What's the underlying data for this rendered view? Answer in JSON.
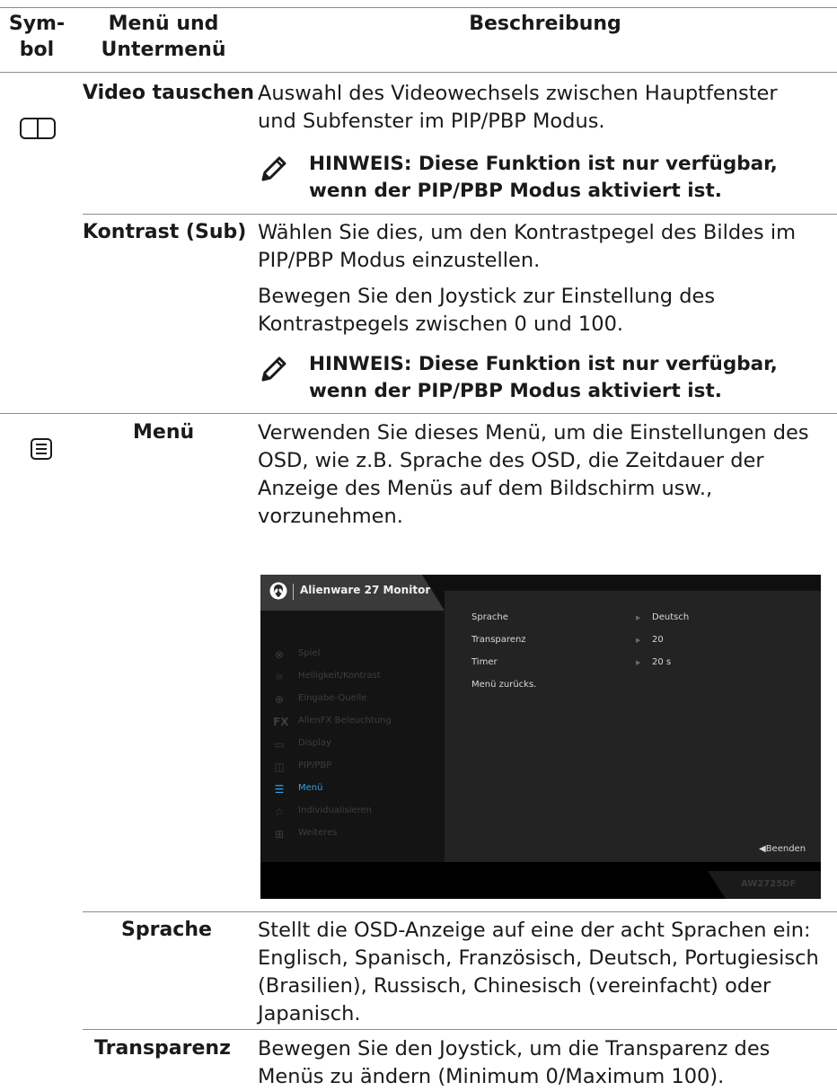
{
  "header": {
    "symbol": [
      "Sym-",
      "bol"
    ],
    "menu": [
      "Menü und",
      "Untermenü"
    ],
    "description": "Beschreibung"
  },
  "rows": {
    "video": {
      "name": "Video tauschen",
      "icon": "split-screen-icon",
      "desc": [
        "Auswahl des Videowechsels zwischen Hauptfenster",
        "und Subfenster im PIP/PBP Modus."
      ],
      "note": [
        "HINWEIS: Diese Funktion ist nur verfügbar,",
        "wenn der PIP/PBP Modus aktiviert ist."
      ]
    },
    "kontrast": {
      "name": "Kontrast (Sub)",
      "desc": [
        "Wählen Sie dies, um den Kontrastpegel des Bildes im",
        "PIP/PBP Modus einzustellen."
      ],
      "desc2": [
        "Bewegen Sie den Joystick zur Einstellung des",
        "Kontrastpegels zwischen 0 und 100."
      ],
      "note": [
        "HINWEIS: Diese Funktion ist nur verfügbar,",
        "wenn der PIP/PBP Modus aktiviert ist."
      ]
    },
    "menu": {
      "name": "Menü",
      "icon": "menu-list-icon",
      "desc": [
        "Verwenden Sie dieses Menü, um die Einstellungen des",
        "OSD, wie z.B. Sprache des OSD, die Zeitdauer der",
        "Anzeige des Menüs auf dem Bildschirm usw.,",
        "vorzunehmen."
      ]
    },
    "sprache": {
      "name": "Sprache",
      "desc": [
        "Stellt die OSD-Anzeige auf eine der acht Sprachen ein:",
        "Englisch, Spanisch, Französisch, Deutsch, Portugiesisch",
        "(Brasilien), Russisch, Chinesisch (vereinfacht) oder",
        "Japanisch."
      ]
    },
    "transparenz": {
      "name": "Transparenz",
      "desc": [
        "Bewegen Sie den Joystick, um die Transparenz des",
        "Menüs zu ändern (Minimum 0/Maximum 100)."
      ]
    }
  },
  "osd": {
    "title": "Alienware 27 Monitor",
    "model": "AW2725DF",
    "exit": "◀Beenden",
    "menu_items": [
      {
        "label": "Spiel",
        "icon": "gamepad-icon"
      },
      {
        "label": "Helligkeit/Kontrast",
        "icon": "brightness-icon"
      },
      {
        "label": "Eingabe-Quelle",
        "icon": "input-source-icon"
      },
      {
        "label": "AlienFX Beleuchtung",
        "icon": "fx-icon"
      },
      {
        "label": "Display",
        "icon": "display-icon"
      },
      {
        "label": "PIP/PBP",
        "icon": "pip-icon"
      },
      {
        "label": "Menü",
        "icon": "menu-icon",
        "active": true
      },
      {
        "label": "Individualisieren",
        "icon": "star-icon"
      },
      {
        "label": "Weiteres",
        "icon": "others-icon"
      }
    ],
    "options": [
      {
        "label": "Sprache",
        "value": "Deutsch"
      },
      {
        "label": "Transparenz",
        "value": "20"
      },
      {
        "label": "Timer",
        "value": "20 s"
      },
      {
        "label": "Menü zurücks.",
        "value": ""
      }
    ],
    "active_color": "#3aa0e6"
  }
}
